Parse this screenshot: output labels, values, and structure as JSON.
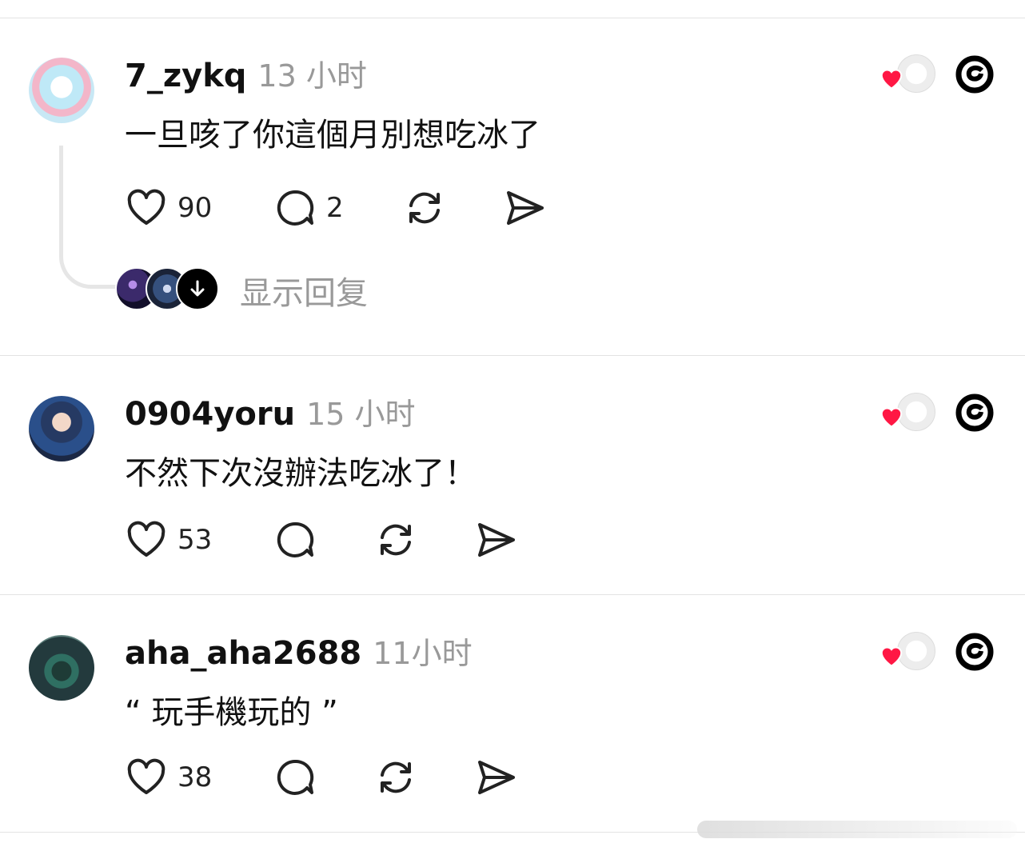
{
  "posts": [
    {
      "username": "7_zykq",
      "time": "13 小时",
      "text": "一旦咳了你這個月別想吃冰了",
      "likes": "90",
      "comments": "2",
      "avatar_icon": "avatar-anime-icon"
    },
    {
      "username": "0904yoru",
      "time": "15 小时",
      "text": "不然下次沒辦法吃冰了！",
      "likes": "53",
      "comments": "",
      "avatar_icon": "avatar-person-icon"
    },
    {
      "username": "aha_aha2688",
      "time": "11小时",
      "text": "“ 玩手機玩的 ”",
      "likes": "38",
      "comments": "",
      "avatar_icon": "avatar-dragon-icon"
    }
  ],
  "show_replies_label": "显示回复",
  "colors": {
    "heart": "#ff1744",
    "muted": "#999999",
    "divider": "#e3e3e3"
  }
}
